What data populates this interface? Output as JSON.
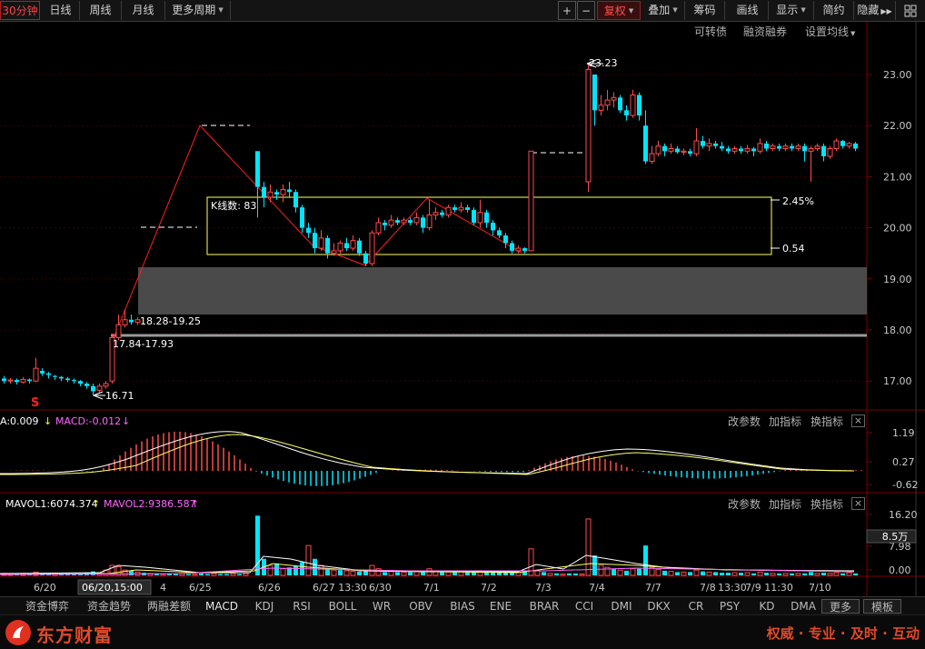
{
  "toolbar": {
    "periods": [
      "30分钟",
      "日线",
      "周线",
      "月线",
      "更多周期"
    ],
    "right": [
      "复权",
      "叠加",
      "筹码",
      "画线",
      "显示",
      "简约",
      "隐藏"
    ],
    "plus": "+",
    "minus": "−",
    "grid_icon": "grid-icon"
  },
  "subtoolbar": {
    "convertible": "可转债",
    "margin": "融资融券",
    "ma_settings": "设置均线"
  },
  "main_chart": {
    "yaxis": [
      "23.00",
      "22.00",
      "21.00",
      "20.00",
      "19.00",
      "18.00",
      "17.00"
    ],
    "xaxis": [
      "6/20",
      "06/20,15:00",
      "4",
      "6/25",
      "6/26",
      "6/27 13:30",
      "6/30",
      "7/1",
      "7/2",
      "7/3",
      "7/4",
      "7/7",
      "7/8",
      "13:30",
      "7/9 11:30",
      "7/10"
    ],
    "annotations": {
      "high": "23.23",
      "low": "16.71",
      "zone1": "18.28-19.25",
      "zone2": "17.84-17.93",
      "box_label": "K线数: 83",
      "box_top_pct": "2.45%",
      "box_bottom_val": "0.54",
      "marker": "S"
    }
  },
  "macd_panel": {
    "label_a": "A:0.009",
    "label_macd": "MACD:-0.012",
    "buttons": [
      "改参数",
      "加指标",
      "换指标"
    ],
    "close": "×",
    "yaxis": [
      "1.19",
      "0.27",
      "-0.62"
    ]
  },
  "vol_panel": {
    "label_v1": "MAVOL1:6074.374",
    "label_v2": "MAVOL2:9386.587",
    "buttons": [
      "改参数",
      "加指标",
      "换指标"
    ],
    "close": "×",
    "yaxis": [
      "16.20",
      "7.98",
      "0.00"
    ],
    "current": "8.5万"
  },
  "tabs": [
    "资金博弈",
    "资金趋势",
    "两融差额",
    "MACD",
    "KDJ",
    "RSI",
    "BOLL",
    "WR",
    "OBV",
    "BIAS",
    "ENE",
    "BRAR",
    "CCI",
    "DMI",
    "DKX",
    "CR",
    "PSY",
    "KD",
    "DMA",
    "更多",
    "模板"
  ],
  "footer": {
    "brand": "东方财富",
    "slogan": "权威 · 专业 · 及时 · 互动"
  },
  "colors": {
    "up": "#ff4a4a",
    "down": "#00e5ff",
    "grid": "#4a0000",
    "box": "#ffff66",
    "bg": "#000000"
  }
}
